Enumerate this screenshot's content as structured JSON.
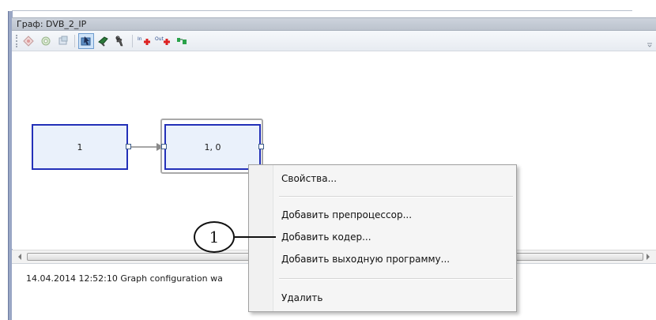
{
  "window": {
    "title": "Граф: DVB_2_IP"
  },
  "toolbar": {
    "buttons": [
      {
        "icon": "diamond-grey-icon"
      },
      {
        "icon": "gear-grey-icon"
      },
      {
        "icon": "layers-grey-icon"
      },
      {
        "icon": "select-pointer-icon",
        "active": true
      },
      {
        "icon": "add-link-icon"
      },
      {
        "icon": "tools-icon"
      },
      {
        "icon": "add-input-icon"
      },
      {
        "icon": "add-output-icon"
      },
      {
        "icon": "arrange-icon"
      }
    ]
  },
  "graph": {
    "nodes": [
      {
        "label": "1"
      },
      {
        "label": "1, 0",
        "selected": true
      }
    ]
  },
  "context_menu": {
    "items": [
      {
        "label": "Свойства..."
      },
      {
        "label": "Добавить препроцессор..."
      },
      {
        "label": "Добавить кодер..."
      },
      {
        "label": "Добавить выходную программу..."
      },
      {
        "label": "Удалить"
      }
    ]
  },
  "log": {
    "line": "14.04.2014 12:52:10 Graph configuration wa"
  },
  "callout": {
    "number": "1"
  },
  "colors": {
    "node_border": "#2330b8",
    "node_fill": "#eaf1fb",
    "title_bar": "#c3c9d3"
  }
}
